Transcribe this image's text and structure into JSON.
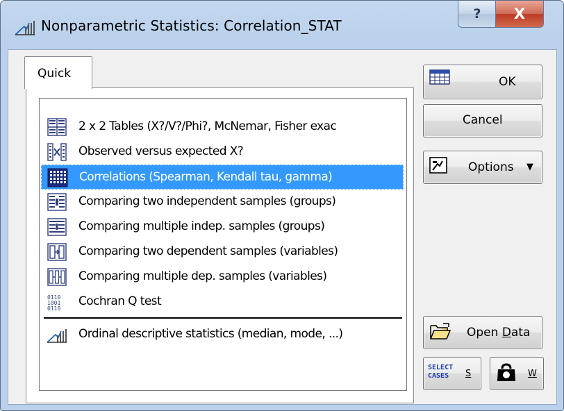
{
  "window": {
    "title": "Nonparametric Statistics: Correlation_STAT",
    "help_label": "?",
    "close_label": "X"
  },
  "tabs": [
    {
      "label": "Quick"
    }
  ],
  "list": {
    "items": [
      {
        "label": "2 x 2 Tables (X?/V?/Phi?, McNemar, Fisher exac",
        "icon": "table-2x2-icon"
      },
      {
        "label": "Observed versus expected X?",
        "icon": "observed-expected-icon"
      },
      {
        "label": "Correlations (Spearman, Kendall tau, gamma)",
        "icon": "correlation-matrix-icon",
        "selected": true
      },
      {
        "label": "Comparing two independent samples (groups)",
        "icon": "two-independent-icon"
      },
      {
        "label": "Comparing multiple indep. samples (groups)",
        "icon": "multiple-independent-icon"
      },
      {
        "label": "Comparing two dependent samples (variables)",
        "icon": "two-dependent-icon"
      },
      {
        "label": "Comparing multiple dep. samples (variables)",
        "icon": "multiple-dependent-icon"
      },
      {
        "label": "Cochran Q test",
        "icon": "binary-data-icon"
      },
      {
        "label": "Ordinal descriptive statistics (median, mode, ...)",
        "icon": "ordinal-stats-icon"
      }
    ]
  },
  "buttons": {
    "ok": "OK",
    "cancel": "Cancel",
    "options": "Options",
    "open_data_prefix": "Open ",
    "open_data_mnemonic": "D",
    "open_data_suffix": "ata",
    "select_cases_line1": "SELECT",
    "select_cases_line2": "CASES",
    "select_cases_key": "S",
    "weight_key": "W"
  },
  "colors": {
    "selection": "#3399ff",
    "title_bar": "#b9d1ec",
    "close_button": "#c7432b"
  }
}
